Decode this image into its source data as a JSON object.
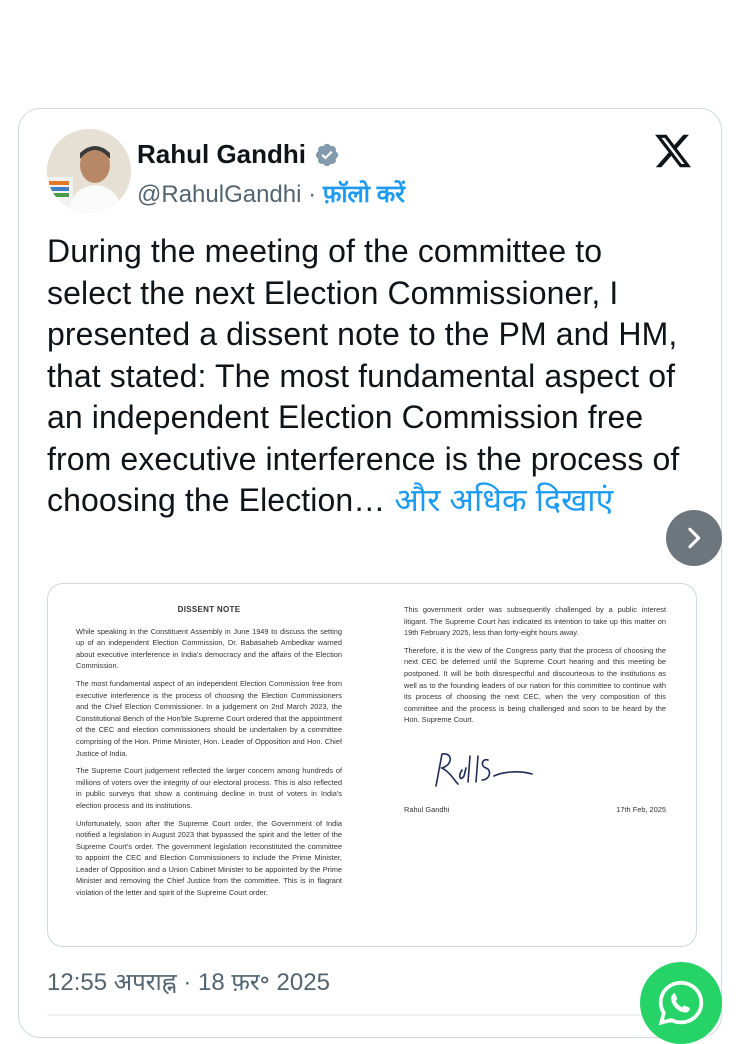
{
  "author": {
    "name": "Rahul Gandhi",
    "handle": "@RahulGandhi",
    "separator": "·",
    "follow_label": "फ़ॉलो करें"
  },
  "tweet": {
    "text": "During the meeting of the committee to select the next Election Commissioner, I presented a dissent note to the PM and HM, that stated: The most fundamental aspect of an independent Election Commission free from executive interference is the process of choosing the Election…",
    "show_more": "और अधिक दिखाएं"
  },
  "document": {
    "title": "DISSENT NOTE",
    "left_paragraphs": [
      "While speaking in the Constituent Assembly in June 1949 to discuss the setting up of an independent Election Commission, Dr. Babasaheb Ambedkar warned about executive interference in India's democracy and the affairs of the Election Commission.",
      "The most fundamental aspect of an independent Election Commission free from executive interference is the process of choosing the Election Commissioners and the Chief Election Commissioner. In a judgement on 2nd March 2023, the Constitutional Bench of the Hon'ble Supreme Court ordered that the appointment of the CEC and election commissioners should be undertaken by a committee comprising of the Hon. Prime Minister, Hon. Leader of Opposition and Hon. Chief Justice of India.",
      "The Supreme Court judgement reflected the larger concern among hundreds of millions of voters over the integrity of our electoral process. This is also reflected in public surveys that show a continuing decline in trust of voters in India's election process and its institutions.",
      "Unfortunately, soon after the Supreme Court order, the Government of India notified a legislation in August 2023 that bypassed the spirit and the letter of the Supreme Court's order. The government legislation reconstituted the committee to appoint the CEC and Election Commissioners to include the Prime Minister, Leader of Opposition and a Union Cabinet Minister to be appointed by the Prime Minister and removing the Chief Justice from the committee. This is in flagrant violation of the letter and spirit of the Supreme Court order."
    ],
    "right_paragraphs": [
      "This government order was subsequently challenged by a public interest litigant. The Supreme Court has indicated its intention to take up this matter on 19th February 2025, less than forty-eight hours away.",
      "Therefore, it is the view of the Congress party that the process of choosing the next CEC be deferred until the Supreme Court hearing and this meeting be postponed. It will be both disrespectful and discourteous to the institutions as well as to the founding leaders of our nation for this committee to continue with its process of choosing the next CEC, when the very composition of this committee and the process is being challenged and soon to be heard by the Hon. Supreme Court."
    ],
    "signatory": "Rahul Gandhi",
    "date": "17th Feb, 2025"
  },
  "timestamp": "12:55 अपराह्न · 18 फ़र॰ 2025",
  "colors": {
    "accent": "#1d9bf0",
    "verified": "#829aab",
    "whatsapp": "#25d366"
  }
}
